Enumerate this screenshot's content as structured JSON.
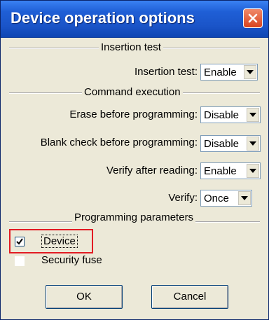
{
  "window": {
    "title": "Device operation options"
  },
  "insertion_test": {
    "group_label": "Insertion test",
    "row_label": "Insertion test:",
    "value": "Enable"
  },
  "command_execution": {
    "group_label": "Command execution",
    "erase": {
      "label": "Erase before programming:",
      "value": "Disable"
    },
    "blank_check": {
      "label": "Blank check before programming:",
      "value": "Disable"
    },
    "verify_after_reading": {
      "label": "Verify after reading:",
      "value": "Enable"
    },
    "verify": {
      "label": "Verify:",
      "value": "Once"
    }
  },
  "programming_parameters": {
    "group_label": "Programming parameters",
    "device": {
      "label": "Device",
      "checked": true
    },
    "security_fuse": {
      "label": "Security fuse",
      "checked": false
    }
  },
  "buttons": {
    "ok": "OK",
    "cancel": "Cancel"
  },
  "colors": {
    "title_bar": "#1f5fd6",
    "highlight": "#e21b23"
  },
  "icons": {
    "close": "close-icon",
    "dropdown": "chevron-down-icon",
    "check": "checkmark-icon"
  }
}
